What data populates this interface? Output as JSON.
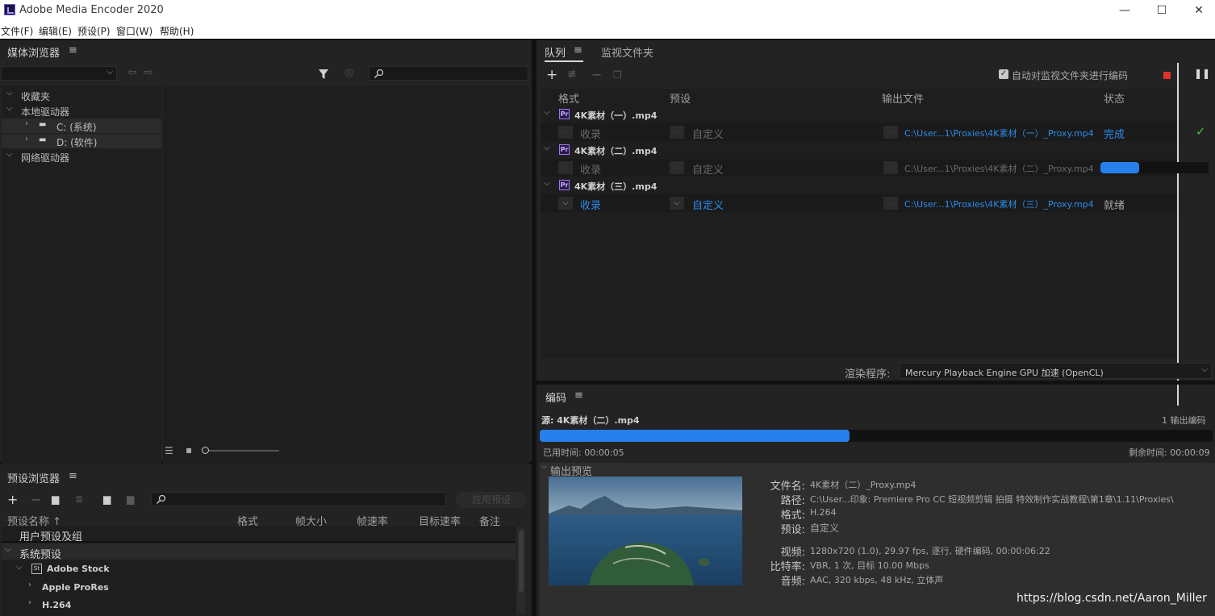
{
  "window": {
    "title": "Adobe Media Encoder 2020",
    "minimize": "—",
    "maximize": "☐",
    "close": "✕"
  },
  "menu": [
    "文件(F)",
    "编辑(E)",
    "预设(P)",
    "窗口(W)",
    "帮助(H)"
  ],
  "media_browser": {
    "title": "媒体浏览器",
    "tree": [
      {
        "label": "收藏夹",
        "level": 0,
        "expanded": true
      },
      {
        "label": "本地驱动器",
        "level": 0,
        "expanded": true
      },
      {
        "label": "C: (系统)",
        "level": 1
      },
      {
        "label": "D: (软件)",
        "level": 1
      },
      {
        "label": "网络驱动器",
        "level": 0,
        "expanded": true
      }
    ]
  },
  "preset_browser": {
    "title": "预设浏览器",
    "apply_label": "应用预设",
    "columns": [
      "预设名称 ↑",
      "格式",
      "帧大小",
      "帧速率",
      "目标速率",
      "备注"
    ],
    "rows": [
      {
        "label": "用户预设及组"
      },
      {
        "label": "系统预设"
      },
      {
        "label": "Adobe Stock",
        "badge": "St"
      },
      {
        "label": "Apple ProRes"
      },
      {
        "label": "H.264"
      }
    ]
  },
  "queue": {
    "tabs": [
      "队列",
      "监视文件夹"
    ],
    "auto_encode_label": "自动对监视文件夹进行编码",
    "columns": [
      "格式",
      "预设",
      "输出文件",
      "状态"
    ],
    "items": [
      {
        "name": "4K素材（一）.mp4",
        "format": "收录",
        "preset": "自定义",
        "output": "C:\\User...1\\Proxies\\4K素材（一）_Proxy.mp4",
        "status": "完成",
        "check": "✓"
      },
      {
        "name": "4K素材（二）.mp4",
        "format": "收录",
        "preset": "自定义",
        "output": "C:\\User...1\\Proxies\\4K素材（二）_Proxy.mp4",
        "status": "",
        "progress": 0.36
      },
      {
        "name": "4K素材（三）.mp4",
        "format": "收录",
        "preset": "自定义",
        "output": "C:\\User...1\\Proxies\\4K素材（三）_Proxy.mp4",
        "status": "就绪"
      }
    ],
    "renderer_label": "渲染程序:",
    "renderer_value": "Mercury Playback Engine GPU 加速 (OpenCL)"
  },
  "encoding": {
    "title": "编码",
    "source": "源: 4K素材（二）.mp4",
    "outputs": "1 输出编码",
    "progress": 0.46,
    "elapsed": "已用时间: 00:00:05",
    "remaining": "剩余时间: 00:00:09",
    "preview_label": "输出预览",
    "info": [
      {
        "k": "文件名:",
        "v": "4K素材（二）_Proxy.mp4"
      },
      {
        "k": "路径:",
        "v": "C:\\User...印象: Premiere Pro CC 短视频剪辑 拍摄 特效制作实战教程\\第1章\\1.11\\Proxies\\"
      },
      {
        "k": "格式:",
        "v": "H.264"
      },
      {
        "k": "预设:",
        "v": "自定义"
      },
      {
        "k": "视频:",
        "v": "1280x720 (1.0), 29.97 fps, 逐行, 硬件编码, 00:00:06:22"
      },
      {
        "k": "比特率:",
        "v": "VBR, 1 次, 目标 10.00 Mbps"
      },
      {
        "k": "音频:",
        "v": "AAC, 320 kbps, 48 kHz, 立体声"
      }
    ],
    "watermark": "https://blog.csdn.net/Aaron_Miller"
  },
  "colors": {
    "accent": "#2680eb",
    "bg": "#232323",
    "done": "#3fbf4f",
    "stop": "#e0312f"
  }
}
